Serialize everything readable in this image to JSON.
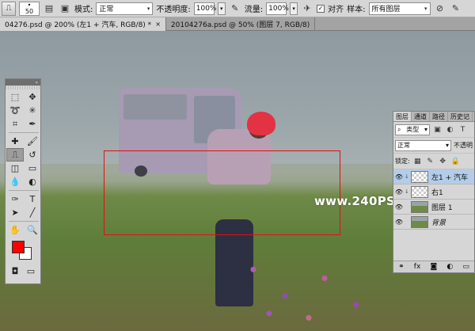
{
  "options_bar": {
    "brush_size": "50",
    "mode_label": "模式:",
    "mode_value": "正常",
    "opacity_label": "不透明度:",
    "opacity_value": "100%",
    "flow_label": "流量:",
    "flow_value": "100%",
    "align_label": "对齐",
    "sample_label": "样本:",
    "sample_value": "所有图层"
  },
  "doc_tabs": [
    {
      "label": "04276.psd @ 200% (左1 + 汽车, RGB/8) *",
      "active": true
    },
    {
      "label": "20104276a.psd @ 50% (图层 7, RGB/8)",
      "active": false
    }
  ],
  "watermark": "www.240PS.com",
  "colors": {
    "foreground": "#ff0000",
    "background": "#ffffff",
    "selection": "#e01010",
    "active_layer": "#b3cde8"
  },
  "layers_panel": {
    "tabs": [
      "图层",
      "通道",
      "路径",
      "历史记"
    ],
    "filter_type": "类型",
    "blend_mode": "正常",
    "opacity_label": "不透明",
    "lock_label": "锁定:",
    "layers": [
      {
        "name": "左1 + 汽车",
        "visible": true,
        "active": true,
        "italic": false
      },
      {
        "name": "右1",
        "visible": true,
        "active": false,
        "italic": false
      },
      {
        "name": "图层 1",
        "visible": true,
        "active": false,
        "italic": false
      },
      {
        "name": "背景",
        "visible": true,
        "active": false,
        "italic": true
      }
    ]
  }
}
